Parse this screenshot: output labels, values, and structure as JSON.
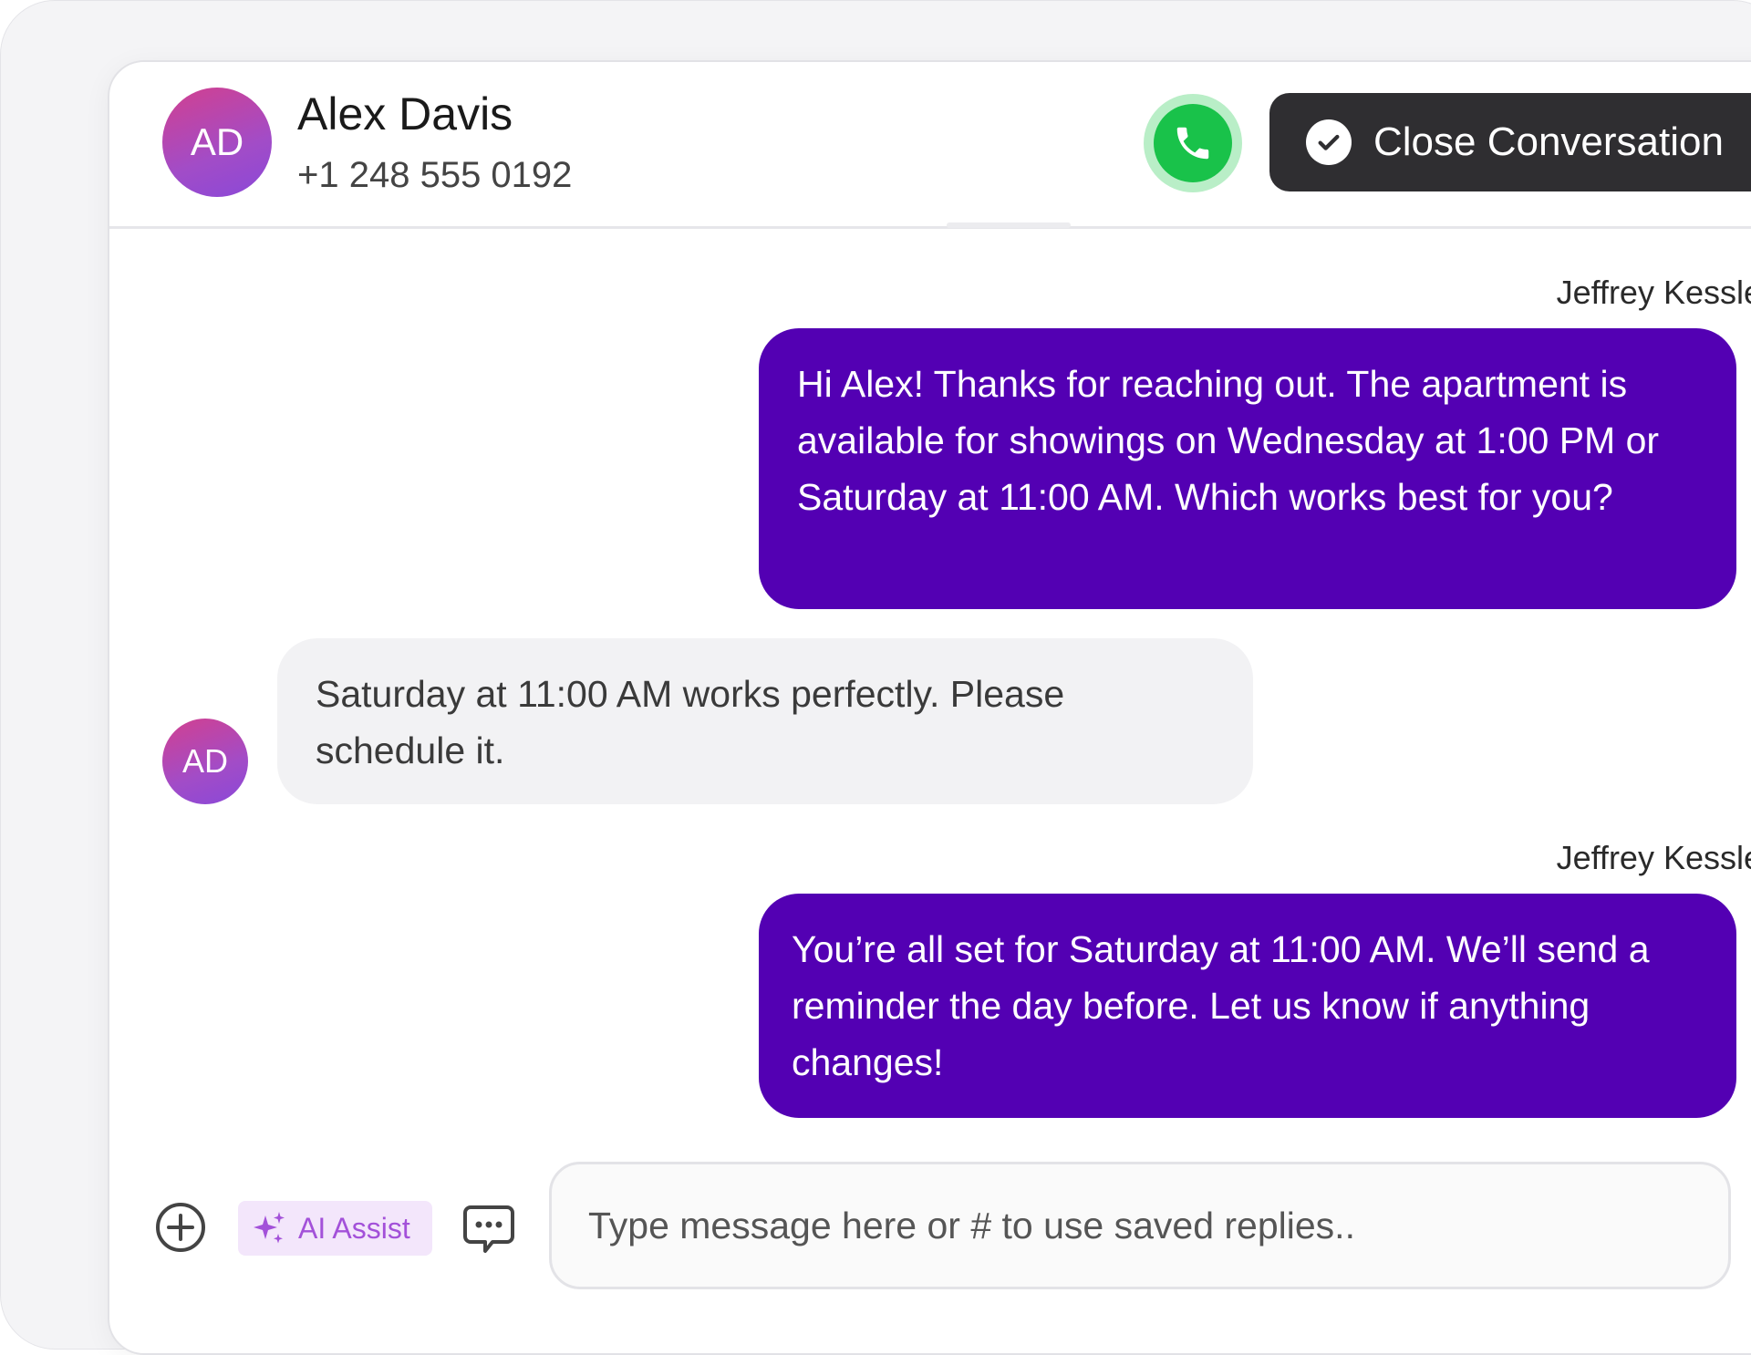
{
  "contact": {
    "initials": "AD",
    "name": "Alex Davis",
    "phone": "+1 248 555 0192"
  },
  "header_actions": {
    "call_icon": "phone-icon",
    "close_conversation_label": "Close Conversation",
    "close_icon": "check-circle-icon"
  },
  "messages": [
    {
      "direction": "outgoing",
      "sender": "Jeffrey Kessler",
      "text": "Hi Alex! Thanks for reaching out. The apartment is available for showings on Wednesday at 1:00 PM or Saturday at 11:00 AM. Which works best for you?"
    },
    {
      "direction": "incoming",
      "avatar_initials": "AD",
      "text": "Saturday at 11:00 AM works perfectly. Please schedule it."
    },
    {
      "direction": "outgoing",
      "sender": "Jeffrey Kessler",
      "text": "You’re all set for Saturday at 11:00 AM. We’ll send a reminder the day before. Let us know if anything changes!"
    }
  ],
  "composer": {
    "add_icon": "plus-circle-icon",
    "ai_assist_label": "AI Assist",
    "ai_icon": "sparkles-icon",
    "saved_replies_icon": "chat-bubble-icon",
    "placeholder": "Type message here or # to use saved replies.."
  },
  "colors": {
    "outgoing_bubble": "#5300b3",
    "incoming_bubble": "#f2f2f4",
    "call_green": "#19c24a",
    "close_button": "#2f2e31",
    "ai_accent": "#a351d9"
  }
}
